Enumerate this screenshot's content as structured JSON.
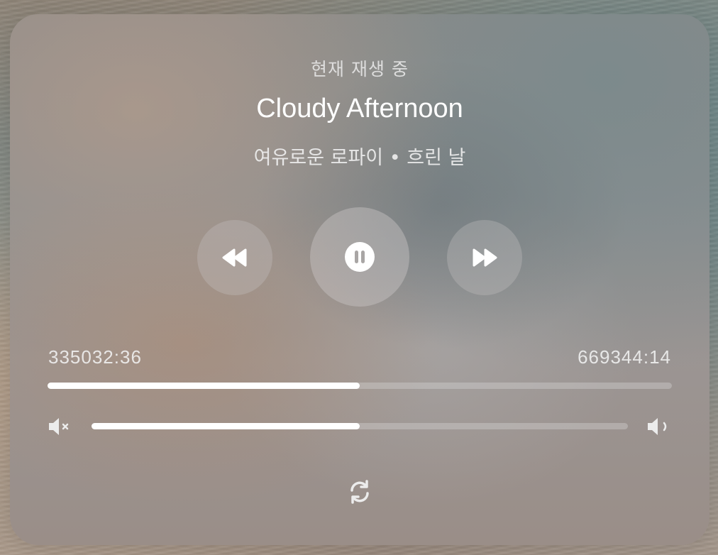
{
  "player": {
    "header_label": "현재 재생 중",
    "title": "Cloudy Afternoon",
    "subtitle": "여유로운 로파이 • 흐린 날"
  },
  "controls": {
    "prev_icon": "rewind-icon",
    "play_pause_icon": "pause-icon",
    "next_icon": "fast-forward-icon",
    "is_playing": true
  },
  "progress": {
    "elapsed": "335032:36",
    "total": "669344:14",
    "fraction": 0.5
  },
  "volume": {
    "min_icon": "volume-mute-icon",
    "max_icon": "volume-high-icon",
    "fraction": 0.5
  },
  "footer": {
    "repeat_icon": "repeat-icon"
  },
  "colors": {
    "text_primary": "#ffffff",
    "fill": "#ffffff"
  }
}
